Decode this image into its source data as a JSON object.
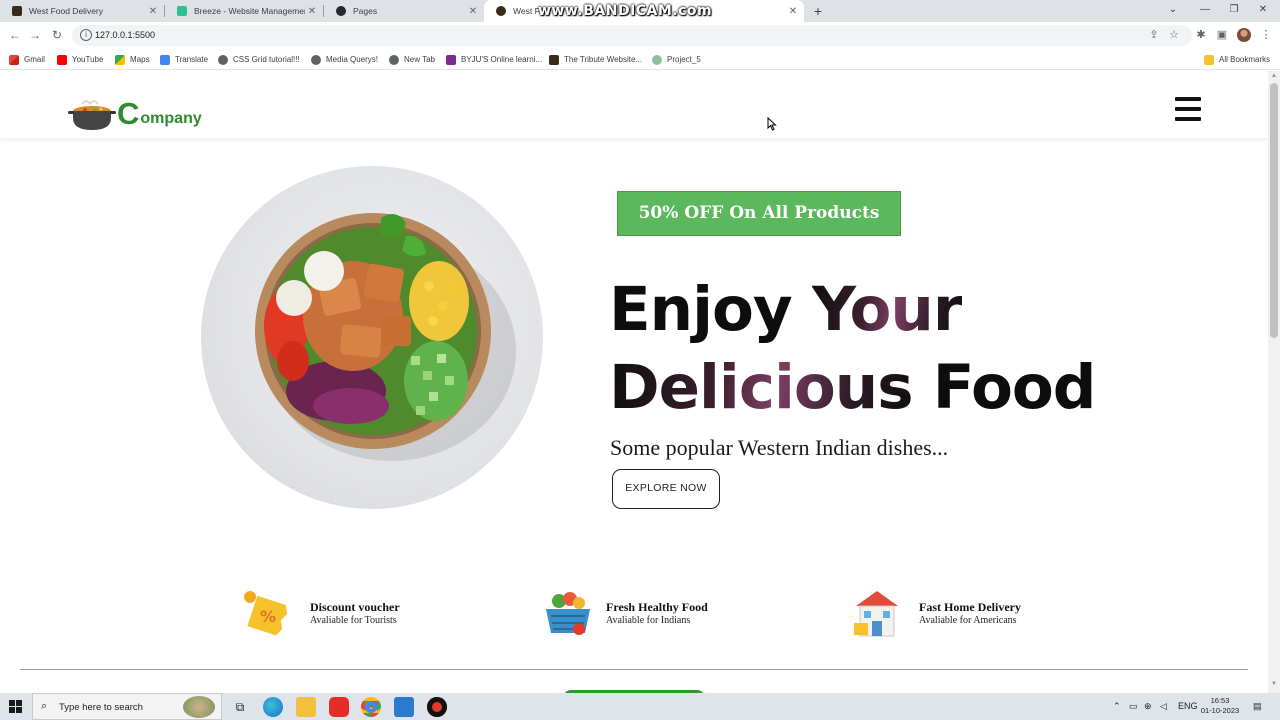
{
  "browser": {
    "tabs": [
      {
        "label": "West Food Delivery",
        "active": false
      },
      {
        "label": "Breeze - Website Management",
        "active": false
      },
      {
        "label": "Pages",
        "active": false
      },
      {
        "label": "West Fo",
        "active": true
      }
    ],
    "url": "127.0.0.1:5500",
    "bookmarks": [
      {
        "label": "Gmail",
        "icon": "gmail-icon"
      },
      {
        "label": "YouTube",
        "icon": "youtube-icon"
      },
      {
        "label": "Maps",
        "icon": "maps-icon"
      },
      {
        "label": "Translate",
        "icon": "translate-icon"
      },
      {
        "label": "CSS Grid tutorial!!!",
        "icon": "globe-icon"
      },
      {
        "label": "Media Querys!",
        "icon": "globe-icon"
      },
      {
        "label": "New Tab",
        "icon": "globe-icon"
      },
      {
        "label": "BYJU'S Online learni...",
        "icon": "byjus-icon"
      },
      {
        "label": "The Tribute Website...",
        "icon": "food-icon"
      },
      {
        "label": "Project_5",
        "icon": "globe-icon"
      }
    ],
    "all_bookmarks": "All Bookmarks",
    "watermark": "www.BANDICAM.com"
  },
  "site": {
    "logo": {
      "first_letter": "C",
      "rest": "ompany"
    },
    "offer_label": "50% OFF On All Products",
    "headline": {
      "line1a": "Enjoy ",
      "line1b": "Your",
      "line2a": "Delicious",
      "line2b": " Food"
    },
    "subtitle": "Some popular Western Indian dishes...",
    "cta": "EXPLORE NOW",
    "features": [
      {
        "title": "Discount voucher",
        "subtitle": "Avaliable for Tourists",
        "icon": "voucher-icon"
      },
      {
        "title": "Fresh Healthy Food",
        "subtitle": "Avaliable for Indians",
        "icon": "basket-icon"
      },
      {
        "title": "Fast Home Delivery",
        "subtitle": "Avaliable for Americans",
        "icon": "home-icon"
      }
    ]
  },
  "taskbar": {
    "search_placeholder": "Type here to search",
    "language": "ENG",
    "time": "16:53",
    "date": "01-10-2023"
  },
  "colors": {
    "brand_green": "#2e8b2e",
    "offer_green": "#5cb85c",
    "text_dark": "#0d0d0d"
  }
}
